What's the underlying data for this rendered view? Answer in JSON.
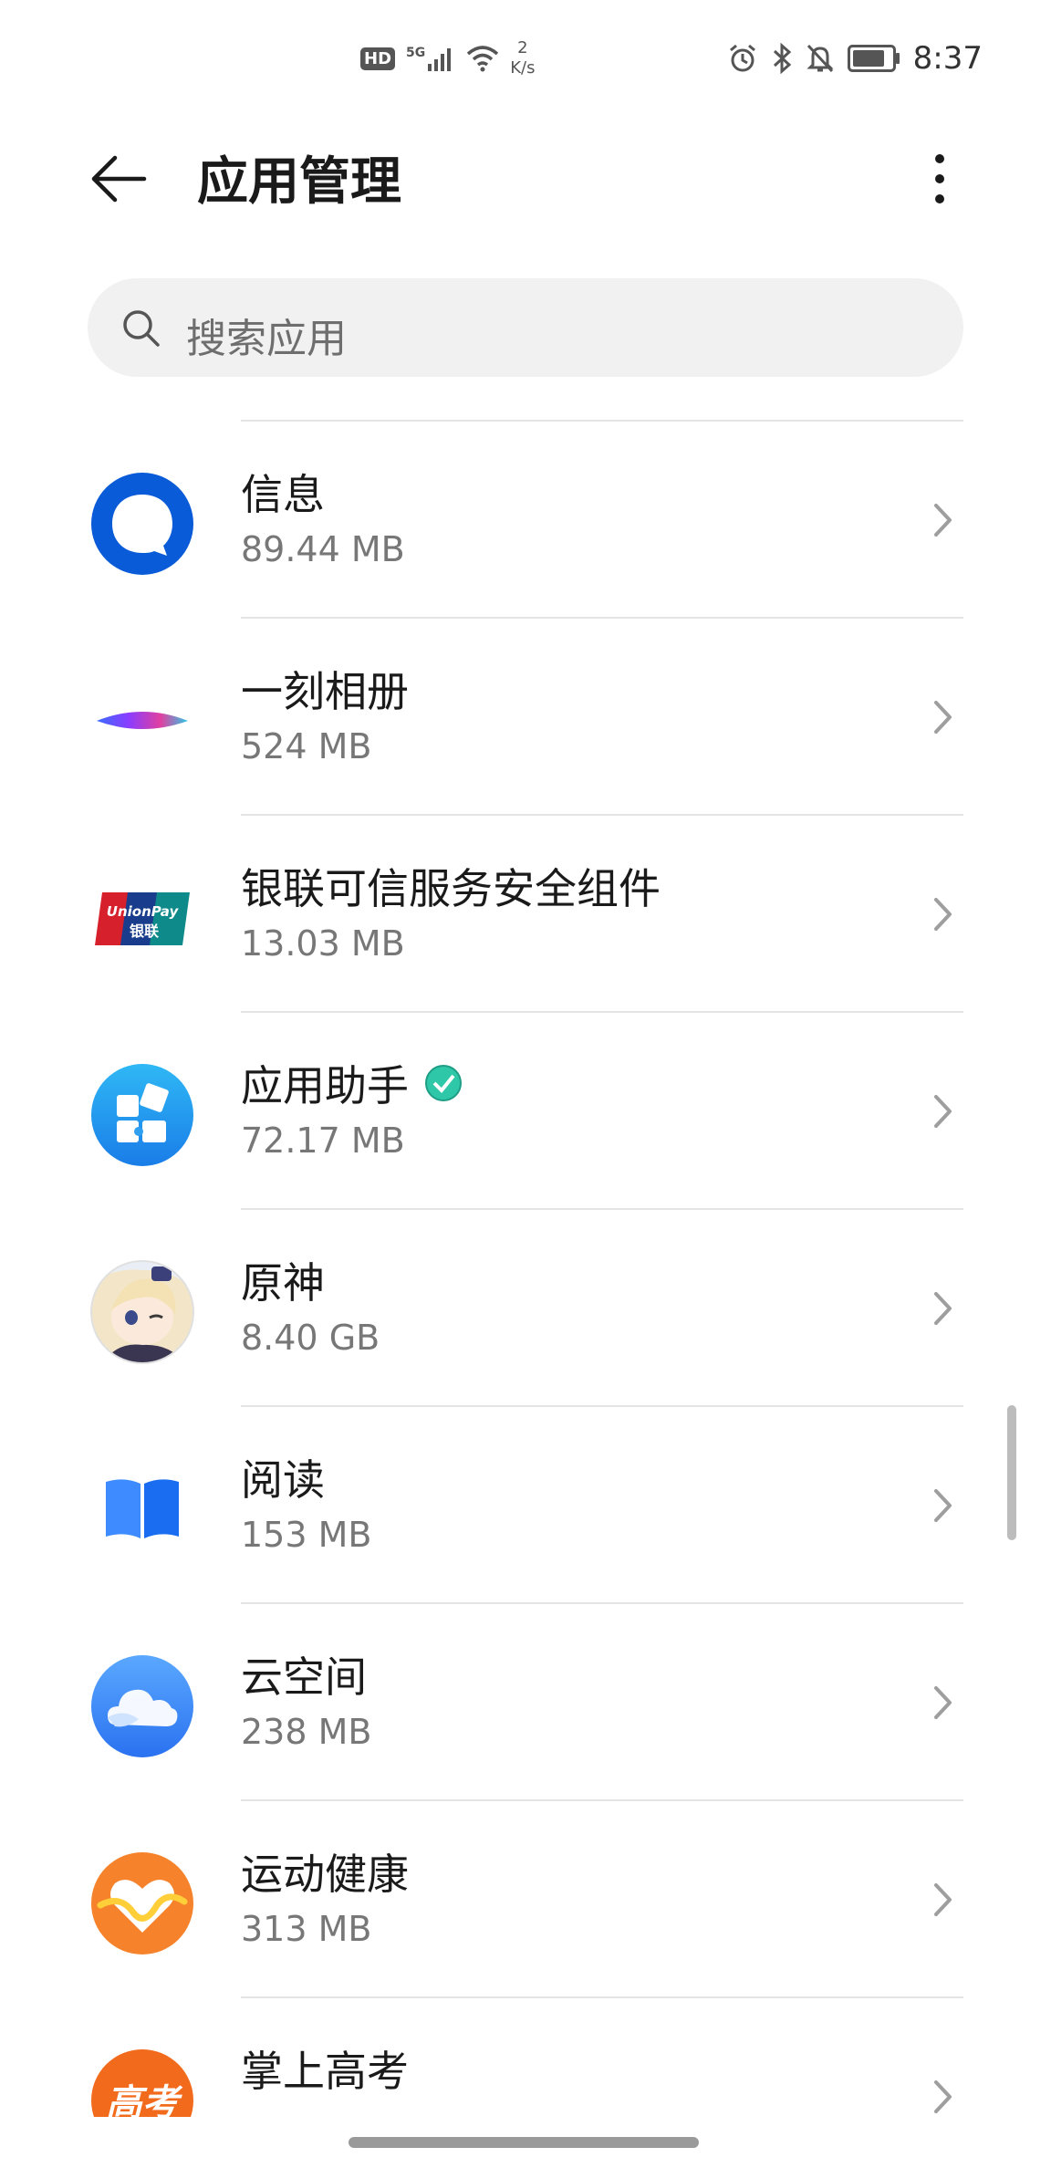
{
  "status_bar": {
    "hd": "HD",
    "network": "5G",
    "speed_value": "2",
    "speed_unit": "K/s",
    "time": "8:37",
    "battery_level": 0.8
  },
  "header": {
    "title": "应用管理"
  },
  "search": {
    "placeholder": "搜索应用"
  },
  "apps": [
    {
      "name": "信息",
      "size": "89.44 MB",
      "icon": "message-icon"
    },
    {
      "name": "一刻相册",
      "size": "524 MB",
      "icon": "yike-album-icon"
    },
    {
      "name": "银联可信服务安全组件",
      "size": "13.03 MB",
      "icon": "unionpay-icon",
      "icon_text": "UnionPay",
      "icon_subtext": "银联"
    },
    {
      "name": "应用助手",
      "size": "72.17 MB",
      "icon": "puzzle-icon",
      "badge": "verified-badge-icon"
    },
    {
      "name": "原神",
      "size": "8.40 GB",
      "icon": "genshin-icon"
    },
    {
      "name": "阅读",
      "size": "153 MB",
      "icon": "book-icon"
    },
    {
      "name": "云空间",
      "size": "238 MB",
      "icon": "cloud-icon"
    },
    {
      "name": "运动健康",
      "size": "313 MB",
      "icon": "health-heart-icon"
    },
    {
      "name": "掌上高考",
      "size": "",
      "icon": "gaokao-icon",
      "icon_text": "高考"
    }
  ],
  "colors": {
    "accent_blue": "#0a5bd8",
    "health_orange": "#f6832b",
    "gaokao_orange": "#f26b1d"
  }
}
